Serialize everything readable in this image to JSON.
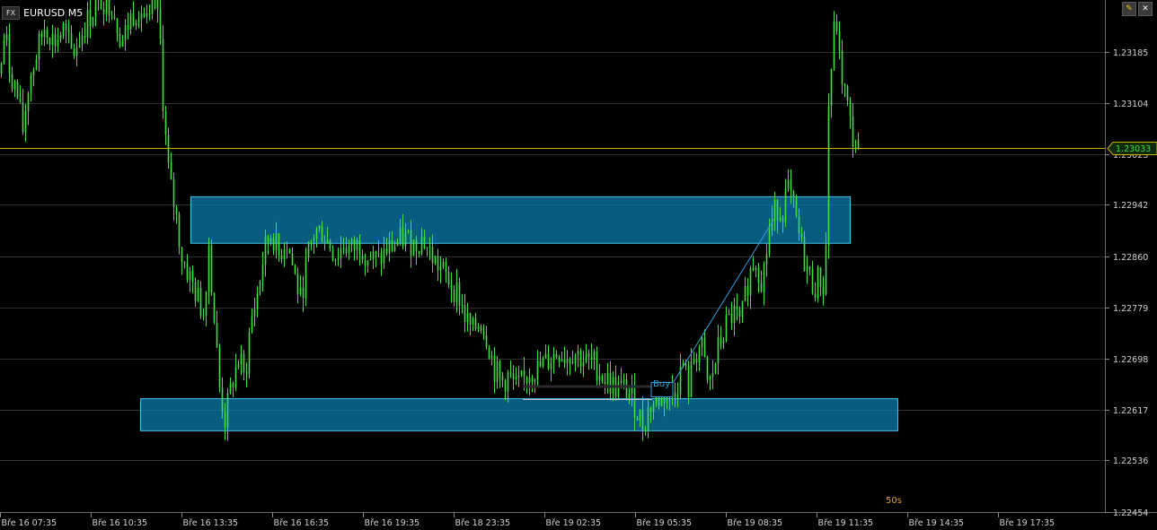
{
  "symbol": {
    "badge": "FX",
    "label": "EURUSD M5"
  },
  "window_controls": {
    "edit_icon": "pencil-icon",
    "close_icon": "close-icon",
    "edit_glyph": "✎",
    "close_glyph": "✕"
  },
  "countdown": "50s",
  "order": {
    "label": "Buy",
    "color": "#2e9fd8"
  },
  "colors": {
    "background": "#000000",
    "candles": "#3fe03f",
    "grid": "#2e2e2e",
    "axis_text": "#d0d0d0",
    "zone_fill": "#0a7fb0",
    "zone_stroke": "#3fc0ee",
    "current_price_line": "#c8b000",
    "current_price_text": "#3fe03f",
    "trend_line": "#3a9be0"
  },
  "chart_data": {
    "type": "candlestick",
    "symbol": "EURUSD",
    "timeframe": "M5",
    "y_ticks": [
      "1.23185",
      "1.23104",
      "1.23023",
      "1.22942",
      "1.22860",
      "1.22779",
      "1.22698",
      "1.22617",
      "1.22536",
      "1.22454"
    ],
    "y_tick_values": [
      1.23185,
      1.23104,
      1.23023,
      1.22942,
      1.2286,
      1.22779,
      1.22698,
      1.22617,
      1.22536,
      1.22454
    ],
    "ylim": [
      1.2244,
      1.23265
    ],
    "current_price": "1.23033",
    "current_price_value": 1.23033,
    "x_ticks": [
      "Bře 16 07:35",
      "Bře 16 10:35",
      "Bře 16 13:35",
      "Bře 16 16:35",
      "Bře 16 19:35",
      "Bře 18 23:35",
      "Bře 19 02:35",
      "Bře 19 05:35",
      "Bře 19 08:35",
      "Bře 19 11:35",
      "Bře 19 14:35",
      "Bře 19 17:35"
    ],
    "price_path": [
      [
        0,
        1.2315
      ],
      [
        5,
        1.2322
      ],
      [
        10,
        1.2316
      ],
      [
        18,
        1.2312
      ],
      [
        25,
        1.2306
      ],
      [
        32,
        1.2314
      ],
      [
        40,
        1.2318
      ],
      [
        50,
        1.2323
      ],
      [
        60,
        1.232
      ],
      [
        70,
        1.2322
      ],
      [
        80,
        1.2318
      ],
      [
        95,
        1.2323
      ],
      [
        110,
        1.2327
      ],
      [
        125,
        1.2326
      ],
      [
        135,
        1.232
      ],
      [
        145,
        1.2324
      ],
      [
        155,
        1.2326
      ],
      [
        165,
        1.2322
      ],
      [
        172,
        1.2327
      ],
      [
        178,
        1.232
      ],
      [
        182,
        1.2308
      ],
      [
        188,
        1.2298
      ],
      [
        195,
        1.2293
      ],
      [
        202,
        1.2286
      ],
      [
        210,
        1.2283
      ],
      [
        218,
        1.228
      ],
      [
        226,
        1.2277
      ],
      [
        232,
        1.2288
      ],
      [
        238,
        1.2276
      ],
      [
        244,
        1.2265
      ],
      [
        250,
        1.226
      ],
      [
        258,
        1.2266
      ],
      [
        266,
        1.227
      ],
      [
        272,
        1.2266
      ],
      [
        278,
        1.2275
      ],
      [
        286,
        1.228
      ],
      [
        294,
        1.2287
      ],
      [
        302,
        1.229
      ],
      [
        310,
        1.2286
      ],
      [
        318,
        1.2289
      ],
      [
        326,
        1.2284
      ],
      [
        334,
        1.2279
      ],
      [
        342,
        1.2286
      ],
      [
        350,
        1.229
      ],
      [
        358,
        1.229
      ],
      [
        366,
        1.2288
      ],
      [
        374,
        1.2286
      ],
      [
        382,
        1.2288
      ],
      [
        390,
        1.2287
      ],
      [
        400,
        1.2288
      ],
      [
        410,
        1.2286
      ],
      [
        420,
        1.2285
      ],
      [
        430,
        1.2287
      ],
      [
        440,
        1.2288
      ],
      [
        450,
        1.2289
      ],
      [
        460,
        1.2288
      ],
      [
        470,
        1.2289
      ],
      [
        480,
        1.2286
      ],
      [
        490,
        1.2284
      ],
      [
        500,
        1.2282
      ],
      [
        510,
        1.228
      ],
      [
        518,
        1.2276
      ],
      [
        526,
        1.2274
      ],
      [
        534,
        1.2276
      ],
      [
        542,
        1.2273
      ],
      [
        550,
        1.2268
      ],
      [
        558,
        1.2266
      ],
      [
        566,
        1.2267
      ],
      [
        574,
        1.2265
      ],
      [
        582,
        1.2266
      ],
      [
        590,
        1.2268
      ],
      [
        598,
        1.2268
      ],
      [
        606,
        1.2269
      ],
      [
        614,
        1.227
      ],
      [
        622,
        1.2271
      ],
      [
        630,
        1.227
      ],
      [
        638,
        1.2271
      ],
      [
        646,
        1.227
      ],
      [
        654,
        1.2269
      ],
      [
        662,
        1.2269
      ],
      [
        670,
        1.2267
      ],
      [
        678,
        1.2266
      ],
      [
        686,
        1.2265
      ],
      [
        694,
        1.2265
      ],
      [
        702,
        1.2264
      ],
      [
        710,
        1.2261
      ],
      [
        716,
        1.2259
      ],
      [
        722,
        1.2262
      ],
      [
        730,
        1.2263
      ],
      [
        738,
        1.2264
      ],
      [
        746,
        1.2264
      ],
      [
        754,
        1.2266
      ],
      [
        760,
        1.2269
      ],
      [
        766,
        1.2265
      ],
      [
        772,
        1.227
      ],
      [
        780,
        1.2272
      ],
      [
        788,
        1.2265
      ],
      [
        794,
        1.2268
      ],
      [
        800,
        1.2272
      ],
      [
        808,
        1.2275
      ],
      [
        816,
        1.2277
      ],
      [
        824,
        1.2275
      ],
      [
        832,
        1.2282
      ],
      [
        840,
        1.2286
      ],
      [
        848,
        1.2282
      ],
      [
        856,
        1.229
      ],
      [
        864,
        1.2294
      ],
      [
        870,
        1.2293
      ],
      [
        876,
        1.2297
      ],
      [
        882,
        1.2294
      ],
      [
        888,
        1.229
      ],
      [
        894,
        1.2286
      ],
      [
        900,
        1.2283
      ],
      [
        906,
        1.2281
      ],
      [
        912,
        1.2283
      ],
      [
        918,
        1.228
      ],
      [
        922,
        1.231
      ],
      [
        926,
        1.2318
      ],
      [
        930,
        1.2325
      ],
      [
        934,
        1.2317
      ],
      [
        940,
        1.2312
      ],
      [
        946,
        1.2307
      ],
      [
        950,
        1.2304
      ],
      [
        956,
        1.2303
      ]
    ],
    "zones": [
      {
        "from": 212,
        "to": 946,
        "price_top": 1.22955,
        "price_bottom": 1.22881
      },
      {
        "from": 156,
        "to": 999,
        "price_top": 1.22634,
        "price_bottom": 1.22583
      }
    ],
    "trend_line": [
      [
        741,
        1.2264
      ],
      [
        862,
        1.2292
      ]
    ],
    "order_line": {
      "from": 582,
      "to": 750,
      "price": 1.22654
    }
  }
}
